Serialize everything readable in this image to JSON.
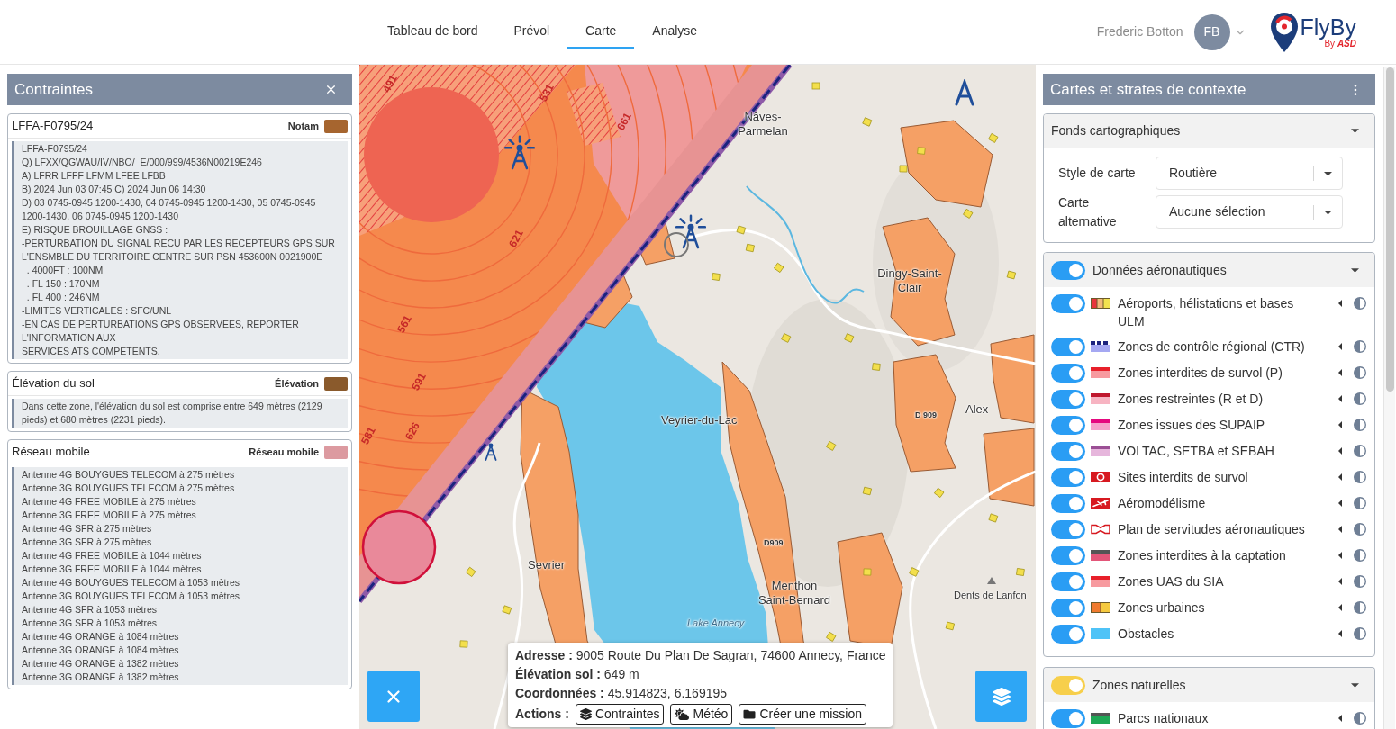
{
  "nav": {
    "tabs": [
      {
        "label": "Tableau de bord",
        "selected": false
      },
      {
        "label": "Prévol",
        "selected": false
      },
      {
        "label": "Carte",
        "selected": true
      },
      {
        "label": "Analyse",
        "selected": false
      }
    ]
  },
  "user": {
    "name": "Frederic Botton",
    "initials": "FB"
  },
  "logo": {
    "name": "FlyBy",
    "tagline": "By **ASD**"
  },
  "constraints_panel": {
    "title": "Contraintes",
    "cards": [
      {
        "title": "LFFA-F0795/24",
        "tag": "Notam",
        "color": "#a6652f",
        "lines": [
          "LFFA-F0795/24",
          "Q) LFXX/QGWAU/IV/NBO/  E/000/999/4536N00219E246",
          "A) LFRR LFFF LFMM LFEE LFBB",
          "B) 2024 Jun 03 07:45 C) 2024 Jun 06 14:30",
          "D) 03 0745-0945 1200-1430, 04 0745-0945 1200-1430, 05 0745-0945",
          "1200-1430, 06 0745-0945 1200-1430",
          "E) RISQUE BROUILLAGE GNSS :",
          "-PERTURBATION DU SIGNAL RECU PAR LES RECEPTEURS GPS SUR",
          "L'ENSMBLE DU TERRITOIRE CENTRE SUR PSN 453600N 0021900E",
          "  . 4000FT : 100NM",
          "  . FL 150 : 170NM",
          "  . FL 400 : 246NM",
          "-LIMITES VERTICALES : SFC/UNL",
          "-EN CAS DE PERTURBATIONS GPS OBSERVEES, REPORTER",
          "L'INFORMATION AUX",
          "SERVICES ATS COMPETENTS."
        ]
      },
      {
        "title": "Élévation du sol",
        "tag": "Élévation",
        "color": "#8a5a2c",
        "lines": [
          "Dans cette zone, l'élévation du sol est comprise entre 649 mètres (2129 pieds) et 680 mètres (2231 pieds)."
        ]
      },
      {
        "title": "Réseau mobile",
        "tag": "Réseau mobile",
        "color": "#dc9aa0",
        "lines": [
          "Antenne 4G BOUYGUES TELECOM à 275 mètres",
          "Antenne 3G BOUYGUES TELECOM à 275 mètres",
          "Antenne 4G FREE MOBILE à 275 mètres",
          "Antenne 3G FREE MOBILE à 275 mètres",
          "Antenne 4G SFR à 275 mètres",
          "Antenne 3G SFR à 275 mètres",
          "Antenne 4G FREE MOBILE à 1044 mètres",
          "Antenne 3G FREE MOBILE à 1044 mètres",
          "Antenne 4G BOUYGUES TELECOM à 1053 mètres",
          "Antenne 3G BOUYGUES TELECOM à 1053 mètres",
          "Antenne 4G SFR à 1053 mètres",
          "Antenne 3G SFR à 1053 mètres",
          "Antenne 4G ORANGE à 1084 mètres",
          "Antenne 3G ORANGE à 1084 mètres",
          "Antenne 4G ORANGE à 1382 mètres",
          "Antenne 3G ORANGE à 1382 mètres"
        ]
      }
    ]
  },
  "map": {
    "zone_labels": [
      "491",
      "531",
      "661",
      "621",
      "561",
      "591",
      "626",
      "581"
    ],
    "places": [
      {
        "kind": "town",
        "text": "Nâves-Parmelan"
      },
      {
        "kind": "town",
        "text": "Dingy-Saint-Clair"
      },
      {
        "kind": "town",
        "text": "Veyrier-du-Lac"
      },
      {
        "kind": "town",
        "text": "Alex"
      },
      {
        "kind": "road",
        "text": "D 909"
      },
      {
        "kind": "road",
        "text": "D909"
      },
      {
        "kind": "town",
        "text": "Sevrier"
      },
      {
        "kind": "town",
        "text": "Menthon Saint-Bernard"
      },
      {
        "kind": "lake",
        "text": "Lake Annecy"
      },
      {
        "kind": "peak",
        "text": "Dents de Lanfon"
      }
    ],
    "popup": {
      "rows": [
        "**Adresse :** 9005 Route Du Plan De Sagran, 74600 Annecy, France",
        "**Élévation sol :** 649 m",
        "**Coordonnées :** 45.914823, 6.169195"
      ],
      "actions_label": "Actions :",
      "actions": [
        {
          "kind": "constraints",
          "label": "Contraintes"
        },
        {
          "kind": "weather",
          "label": "Météo"
        },
        {
          "kind": "mission",
          "label": "Créer une mission"
        }
      ]
    }
  },
  "layers_panel": {
    "title": "Cartes et strates de contexte",
    "basemaps": {
      "title": "Fonds cartographiques",
      "expanded": true,
      "fields": [
        {
          "label": "Style de carte",
          "value": "Routière"
        },
        {
          "label": "Carte alternative",
          "value": "Aucune sélection"
        }
      ]
    },
    "groups": [
      {
        "title": "Données aéronautiques",
        "on": true,
        "color": "#2a9df4",
        "expanded": true,
        "items": [
          {
            "label": "Aéroports, hélistations et bases ULM",
            "on": true,
            "kind": "blocks",
            "swatch": [
              {
                "color": "#e8343a"
              },
              {
                "color": "#f3b97a"
              },
              {
                "color": "#f2e24f"
              }
            ]
          },
          {
            "label": "Zones de contrôle régional (CTR)",
            "on": true,
            "kind": "dashed",
            "swatch": [
              {
                "color": "#1c237e"
              },
              {
                "color": "#a5a8f2"
              }
            ]
          },
          {
            "label": "Zones interdites de survol (P)",
            "on": true,
            "kind": "bands",
            "swatch": [
              {
                "color": "#e8202a"
              },
              {
                "color": "#f79a9f"
              }
            ]
          },
          {
            "label": "Zones restreintes (R et D)",
            "on": true,
            "kind": "bands",
            "swatch": [
              {
                "color": "#c0182e"
              },
              {
                "color": "#f7b4c2"
              }
            ]
          },
          {
            "label": "Zones issues des SUPAIP",
            "on": true,
            "kind": "bands",
            "swatch": [
              {
                "color": "#e5097f"
              },
              {
                "color": "#f6a2cb"
              }
            ]
          },
          {
            "label": "VOLTAC, SETBA et SEBAH",
            "on": true,
            "kind": "bands",
            "swatch": [
              {
                "color": "#9b4f95"
              },
              {
                "color": "#e6b6dc"
              }
            ]
          },
          {
            "label": "Sites interdits de survol",
            "on": true,
            "kind": "ring",
            "swatch": [
              {
                "color": "#d71920"
              }
            ]
          },
          {
            "label": "Aéromodélisme",
            "on": true,
            "kind": "plane",
            "swatch": [
              {
                "color": "#d71920"
              }
            ]
          },
          {
            "label": "Plan de servitudes aéronautiques",
            "on": true,
            "kind": "bowtie",
            "swatch": [
              {
                "color": "#d71920"
              }
            ]
          },
          {
            "label": "Zones interdites à la captation",
            "on": true,
            "kind": "bands",
            "swatch": [
              {
                "color": "#555555"
              },
              {
                "color": "#e35679"
              }
            ]
          },
          {
            "label": "Zones UAS du SIA",
            "on": true,
            "kind": "bands",
            "swatch": [
              {
                "color": "#e8202a"
              },
              {
                "color": "#f79a9f"
              }
            ]
          },
          {
            "label": "Zones urbaines",
            "on": true,
            "kind": "blocks",
            "swatch": [
              {
                "color": "#f07b2f"
              },
              {
                "color": "#f5c93f"
              }
            ]
          },
          {
            "label": "Obstacles",
            "on": true,
            "kind": "bands",
            "swatch": [
              {
                "color": "#4fc3f7"
              },
              {
                "color": "#4fc3f7"
              }
            ]
          }
        ]
      },
      {
        "title": "Zones naturelles",
        "on": true,
        "color": "#f7cf4b",
        "expanded": true,
        "items": [
          {
            "label": "Parcs nationaux",
            "on": true,
            "kind": "bands",
            "swatch": [
              {
                "color": "#555555"
              },
              {
                "color": "#1fa856"
              }
            ]
          }
        ]
      }
    ]
  }
}
